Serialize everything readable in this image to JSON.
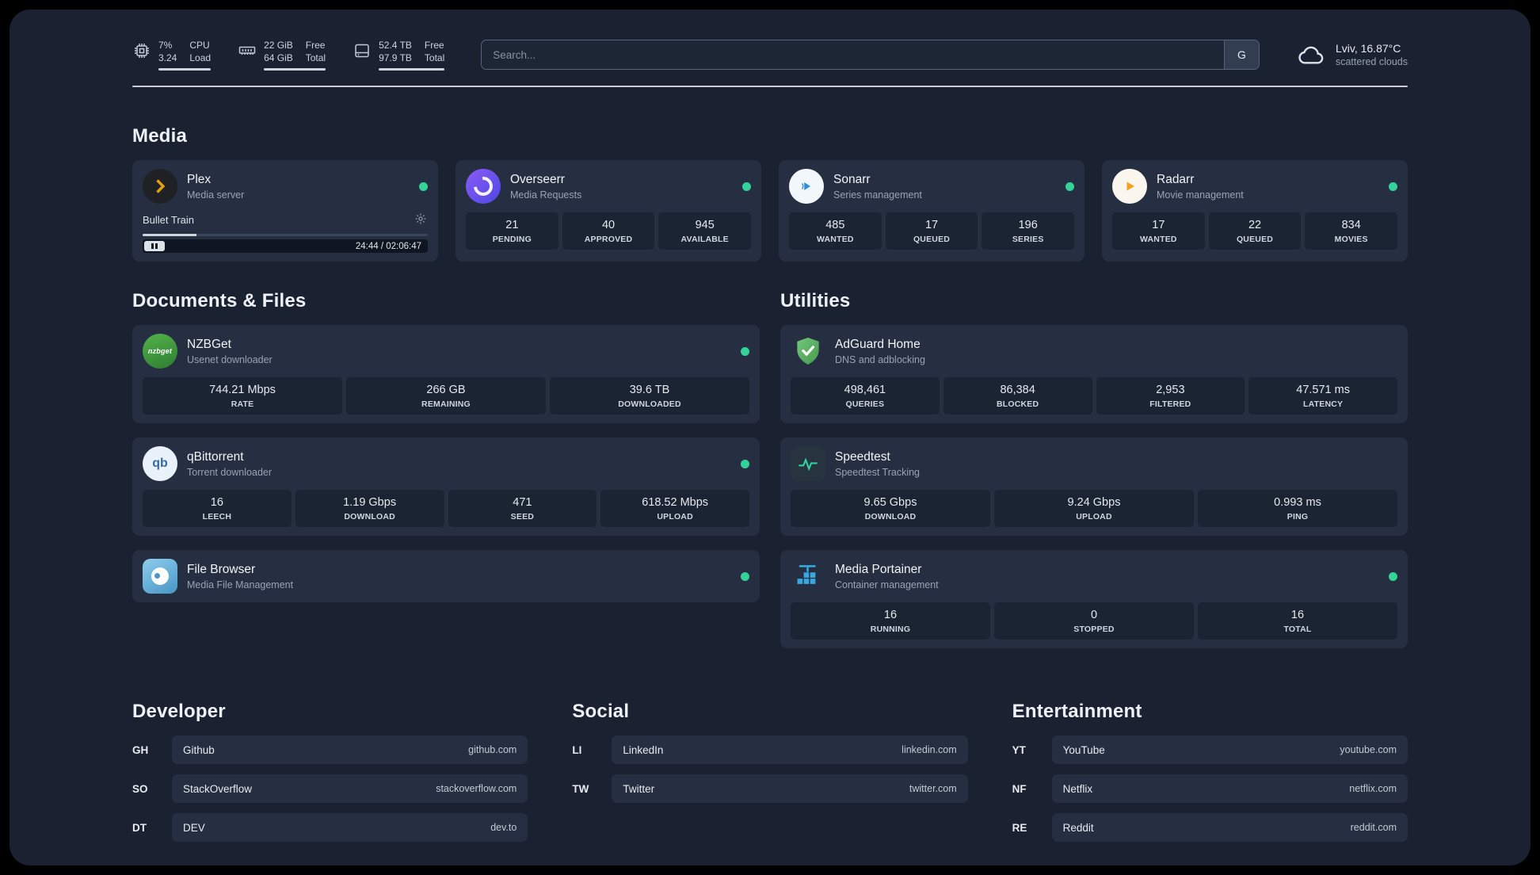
{
  "theme": {
    "accent": "#34d399",
    "status_online": "#34d399",
    "background": "#1a2231",
    "card": "#252f41"
  },
  "header": {
    "resources": [
      {
        "icon": "cpu-icon",
        "values": [
          "7%",
          "3.24"
        ],
        "labels": [
          "CPU",
          "Load"
        ]
      },
      {
        "icon": "memory-icon",
        "values": [
          "22 GiB",
          "64 GiB"
        ],
        "labels": [
          "Free",
          "Total"
        ]
      },
      {
        "icon": "disk-icon",
        "values": [
          "52.4 TB",
          "97.9 TB"
        ],
        "labels": [
          "Free",
          "Total"
        ]
      }
    ],
    "search": {
      "placeholder": "Search...",
      "provider_button": "G"
    },
    "weather": {
      "icon": "cloud-icon",
      "location": "Lviv, 16.87°C",
      "condition": "scattered clouds"
    }
  },
  "sections": {
    "media": {
      "title": "Media",
      "cards": {
        "plex": {
          "icon": "plex-icon",
          "name": "Plex",
          "desc": "Media server",
          "status": "online",
          "now_playing": {
            "title": "Bullet Train",
            "time": "24:44 / 02:06:47",
            "progress_percent": 19
          }
        },
        "overseerr": {
          "icon": "overseerr-icon",
          "name": "Overseerr",
          "desc": "Media Requests",
          "status": "online",
          "stats": [
            {
              "value": "21",
              "label": "PENDING"
            },
            {
              "value": "40",
              "label": "APPROVED"
            },
            {
              "value": "945",
              "label": "AVAILABLE"
            }
          ]
        },
        "sonarr": {
          "icon": "sonarr-icon",
          "name": "Sonarr",
          "desc": "Series management",
          "status": "online",
          "stats": [
            {
              "value": "485",
              "label": "WANTED"
            },
            {
              "value": "17",
              "label": "QUEUED"
            },
            {
              "value": "196",
              "label": "SERIES"
            }
          ]
        },
        "radarr": {
          "icon": "radarr-icon",
          "name": "Radarr",
          "desc": "Movie management",
          "status": "online",
          "stats": [
            {
              "value": "17",
              "label": "WANTED"
            },
            {
              "value": "22",
              "label": "QUEUED"
            },
            {
              "value": "834",
              "label": "MOVIES"
            }
          ]
        }
      }
    },
    "documents": {
      "title": "Documents & Files",
      "cards": {
        "nzbget": {
          "icon": "nzbget-icon",
          "name": "NZBGet",
          "desc": "Usenet downloader",
          "status": "online",
          "stats": [
            {
              "value": "744.21 Mbps",
              "label": "RATE"
            },
            {
              "value": "266 GB",
              "label": "REMAINING"
            },
            {
              "value": "39.6 TB",
              "label": "DOWNLOADED"
            }
          ]
        },
        "qbittorrent": {
          "icon": "qbittorrent-icon",
          "name": "qBittorrent",
          "desc": "Torrent downloader",
          "status": "online",
          "stats": [
            {
              "value": "16",
              "label": "LEECH"
            },
            {
              "value": "1.19 Gbps",
              "label": "DOWNLOAD"
            },
            {
              "value": "471",
              "label": "SEED"
            },
            {
              "value": "618.52 Mbps",
              "label": "UPLOAD"
            }
          ]
        },
        "filebrowser": {
          "icon": "filebrowser-icon",
          "name": "File Browser",
          "desc": "Media File Management",
          "status": "online"
        }
      }
    },
    "utilities": {
      "title": "Utilities",
      "cards": {
        "adguard": {
          "icon": "adguard-icon",
          "name": "AdGuard Home",
          "desc": "DNS and adblocking",
          "stats": [
            {
              "value": "498,461",
              "label": "QUERIES"
            },
            {
              "value": "86,384",
              "label": "BLOCKED"
            },
            {
              "value": "2,953",
              "label": "FILTERED"
            },
            {
              "value": "47.571 ms",
              "label": "LATENCY"
            }
          ]
        },
        "speedtest": {
          "icon": "speedtest-icon",
          "name": "Speedtest",
          "desc": "Speedtest Tracking",
          "stats": [
            {
              "value": "9.65 Gbps",
              "label": "DOWNLOAD"
            },
            {
              "value": "9.24 Gbps",
              "label": "UPLOAD"
            },
            {
              "value": "0.993 ms",
              "label": "PING"
            }
          ]
        },
        "portainer": {
          "icon": "portainer-icon",
          "name": "Media Portainer",
          "desc": "Container management",
          "status": "online",
          "stats": [
            {
              "value": "16",
              "label": "RUNNING"
            },
            {
              "value": "0",
              "label": "STOPPED"
            },
            {
              "value": "16",
              "label": "TOTAL"
            }
          ]
        }
      }
    }
  },
  "bookmarks": {
    "developer": {
      "title": "Developer",
      "items": [
        {
          "abbr": "GH",
          "name": "Github",
          "href": "github.com"
        },
        {
          "abbr": "SO",
          "name": "StackOverflow",
          "href": "stackoverflow.com"
        },
        {
          "abbr": "DT",
          "name": "DEV",
          "href": "dev.to"
        }
      ]
    },
    "social": {
      "title": "Social",
      "items": [
        {
          "abbr": "LI",
          "name": "LinkedIn",
          "href": "linkedin.com"
        },
        {
          "abbr": "TW",
          "name": "Twitter",
          "href": "twitter.com"
        }
      ]
    },
    "entertainment": {
      "title": "Entertainment",
      "items": [
        {
          "abbr": "YT",
          "name": "YouTube",
          "href": "youtube.com"
        },
        {
          "abbr": "NF",
          "name": "Netflix",
          "href": "netflix.com"
        },
        {
          "abbr": "RE",
          "name": "Reddit",
          "href": "reddit.com"
        }
      ]
    }
  }
}
